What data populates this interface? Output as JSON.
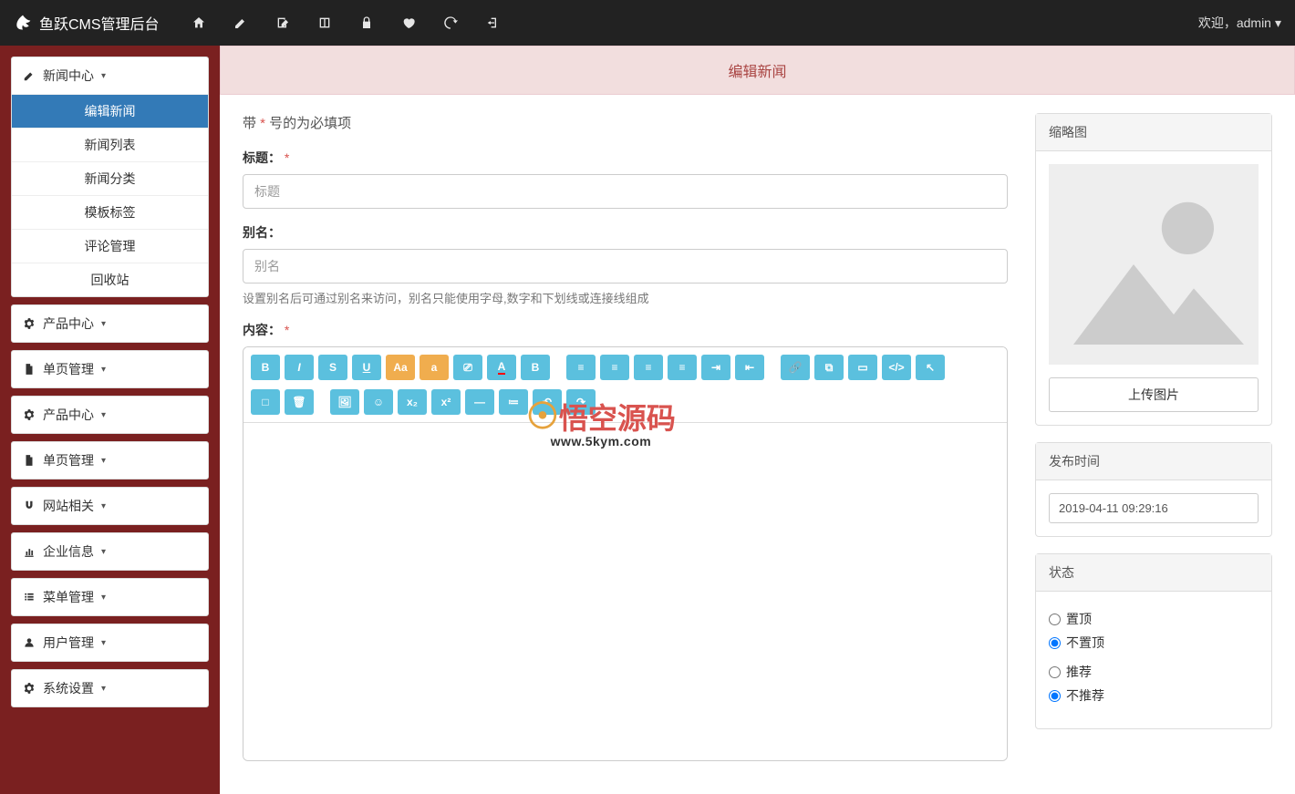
{
  "topbar": {
    "brand": "鱼跃CMS管理后台",
    "welcome_prefix": "欢迎，",
    "username": "admin"
  },
  "sidebar": {
    "groups": [
      {
        "label": "新闻中心",
        "icon": "edit",
        "open": true,
        "items": [
          "编辑新闻",
          "新闻列表",
          "新闻分类",
          "模板标签",
          "评论管理",
          "回收站"
        ],
        "active_index": 0
      },
      {
        "label": "产品中心",
        "icon": "gears"
      },
      {
        "label": "单页管理",
        "icon": "file"
      },
      {
        "label": "产品中心",
        "icon": "gears"
      },
      {
        "label": "单页管理",
        "icon": "file"
      },
      {
        "label": "网站相关",
        "icon": "magnet"
      },
      {
        "label": "企业信息",
        "icon": "bar"
      },
      {
        "label": "菜单管理",
        "icon": "list"
      },
      {
        "label": "用户管理",
        "icon": "user"
      },
      {
        "label": "系统设置",
        "icon": "gear"
      }
    ]
  },
  "page": {
    "title": "编辑新闻",
    "required_hint_pre": "带 ",
    "required_hint_star": "*",
    "required_hint_post": " 号的为必填项"
  },
  "form": {
    "title_label": "标题：",
    "title_placeholder": "标题",
    "alias_label": "别名：",
    "alias_placeholder": "别名",
    "alias_help": "设置别名后可通过别名来访问，别名只能使用字母,数字和下划线或连接线组成",
    "content_label": "内容："
  },
  "watermark": {
    "text": "悟空源码",
    "url": "www.5kym.com"
  },
  "panels": {
    "thumb": {
      "title": "缩略图",
      "upload": "上传图片"
    },
    "pubtime": {
      "title": "发布时间",
      "value": "2019-04-11 09:29:16"
    },
    "status": {
      "title": "状态",
      "top_yes": "置顶",
      "top_no": "不置顶",
      "rec_yes": "推荐",
      "rec_no": "不推荐"
    }
  }
}
